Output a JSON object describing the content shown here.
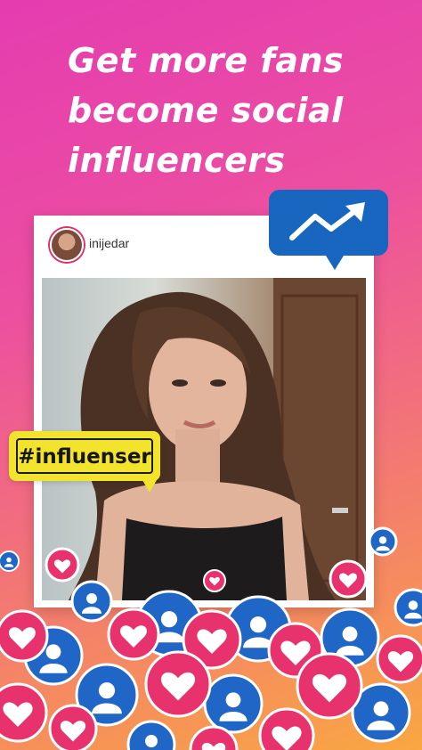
{
  "headline": {
    "line1": "Get more fans",
    "line2": "become social",
    "line3": "influencers"
  },
  "post": {
    "username": "inijedar"
  },
  "hashtag": {
    "label": "#influenser"
  },
  "colors": {
    "gradient_top": "#e53cb0",
    "gradient_bottom": "#f9a742",
    "like_pink": "#e8326e",
    "follow_blue": "#1f66c7",
    "hashtag_yellow": "#f2e32c",
    "trend_blue": "#1966c0"
  },
  "icons": [
    "trending-up-icon",
    "heart-icon",
    "user-icon",
    "avatar"
  ]
}
